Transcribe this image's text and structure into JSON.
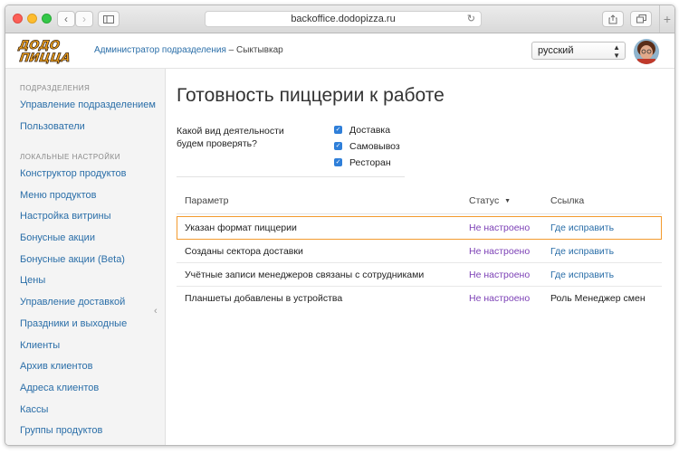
{
  "browser": {
    "url": "backoffice.dodopizza.ru"
  },
  "header": {
    "crumb_link": "Администратор подразделения",
    "crumb_sep": " – ",
    "crumb_city": "Сыктывкар",
    "language": "русский"
  },
  "sidebar": {
    "section1": "ПОДРАЗДЕЛЕНИЯ",
    "section1_items": [
      "Управление подразделением",
      "Пользователи"
    ],
    "section2": "ЛОКАЛЬНЫЕ НАСТРОЙКИ",
    "section2_items": [
      "Конструктор продуктов",
      "Меню продуктов",
      "Настройка витрины",
      "Бонусные акции",
      "Бонусные акции (Beta)",
      "Цены",
      "Управление доставкой",
      "Праздники и выходные",
      "Клиенты",
      "Архив клиентов",
      "Адреса клиентов",
      "Кассы",
      "Группы продуктов"
    ]
  },
  "main": {
    "title": "Готовность пиццерии к работе",
    "question": "Какой вид деятельности будем проверять?",
    "activities": [
      "Доставка",
      "Самовывоз",
      "Ресторан"
    ],
    "table": {
      "headers": [
        "Параметр",
        "Статус",
        "Ссылка"
      ],
      "rows": [
        {
          "param": "Указан формат пиццерии",
          "status": "Не настроено",
          "link": "Где исправить"
        },
        {
          "param": "Созданы сектора доставки",
          "status": "Не настроено",
          "link": "Где исправить"
        },
        {
          "param": "Учётные записи менеджеров связаны с сотрудниками",
          "status": "Не настроено",
          "link": "Где исправить"
        },
        {
          "param": "Планшеты добавлены в устройства",
          "status": "Не настроено",
          "link": "Роль Менеджер смен"
        }
      ]
    }
  },
  "colors": {
    "link": "#2a6ea8",
    "status": "#7b3fb5",
    "highlight": "#f39a2e",
    "checkbox": "#2f7fd9"
  }
}
